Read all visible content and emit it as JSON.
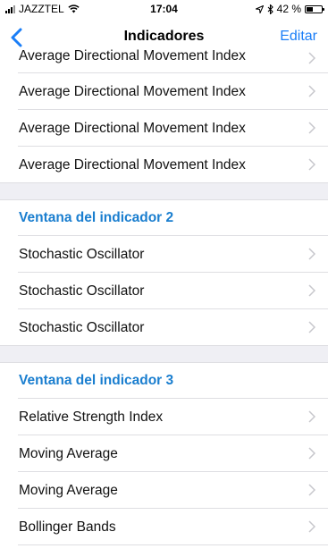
{
  "status_bar": {
    "carrier": "JAZZTEL",
    "time": "17:04",
    "battery": "42 %",
    "battery_level": 0.42
  },
  "nav": {
    "title": "Indicadores",
    "edit_label": "Editar",
    "back_icon": "chevron-left-icon"
  },
  "sections": [
    {
      "items": [
        {
          "label": "Average Directional Movement Index"
        },
        {
          "label": "Average Directional Movement Index"
        },
        {
          "label": "Average Directional Movement Index"
        },
        {
          "label": "Average Directional Movement Index"
        }
      ]
    },
    {
      "title": "Ventana del indicador 2",
      "items": [
        {
          "label": "Stochastic Oscillator"
        },
        {
          "label": "Stochastic Oscillator"
        },
        {
          "label": "Stochastic Oscillator"
        }
      ]
    },
    {
      "title": "Ventana del indicador 3",
      "items": [
        {
          "label": "Relative Strength Index"
        },
        {
          "label": "Moving Average"
        },
        {
          "label": "Moving Average"
        },
        {
          "label": "Bollinger Bands"
        }
      ]
    }
  ],
  "colors": {
    "accent": "#1a7ef7",
    "section_title": "#1a7ecf",
    "group_background": "#efeff4"
  }
}
